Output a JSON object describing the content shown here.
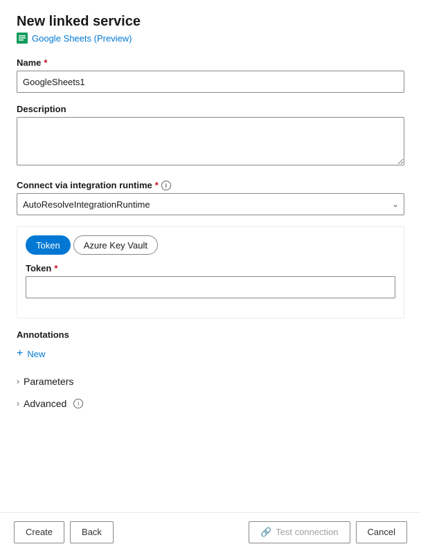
{
  "page": {
    "title": "New linked service",
    "subtitle": "Google Sheets (Preview)",
    "subtitle_color": "#0078d4"
  },
  "form": {
    "name_label": "Name",
    "name_value": "GoogleSheets1",
    "name_placeholder": "",
    "description_label": "Description",
    "description_placeholder": "",
    "runtime_label": "Connect via integration runtime",
    "runtime_value": "AutoResolveIntegrationRuntime",
    "runtime_options": [
      "AutoResolveIntegrationRuntime"
    ],
    "token_tab_label": "Token",
    "azure_key_vault_tab_label": "Azure Key Vault",
    "token_field_label": "Token",
    "token_placeholder": ""
  },
  "annotations": {
    "section_label": "Annotations",
    "new_button_label": "New"
  },
  "parameters": {
    "label": "Parameters"
  },
  "advanced": {
    "label": "Advanced"
  },
  "footer": {
    "create_label": "Create",
    "back_label": "Back",
    "test_connection_label": "Test connection",
    "cancel_label": "Cancel"
  },
  "icons": {
    "chevron_down": "&#8964;",
    "chevron_right": "&#8250;",
    "plus": "+",
    "info": "i",
    "test_conn": "&#128279;"
  }
}
